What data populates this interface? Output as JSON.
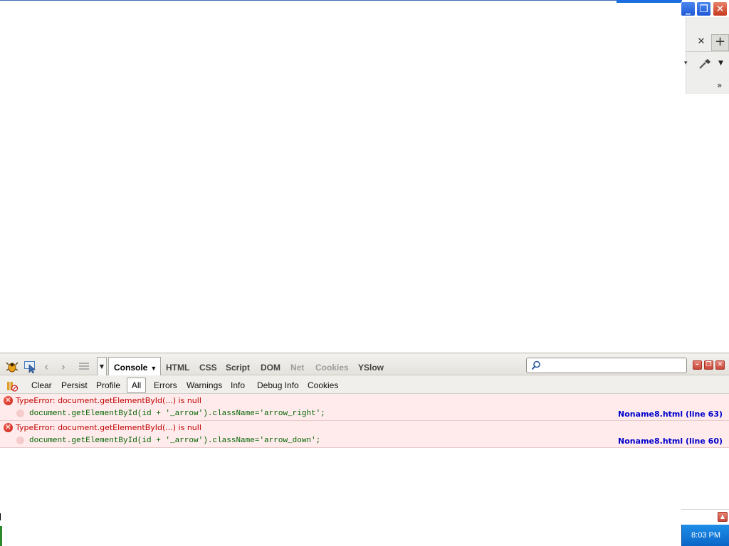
{
  "window": {
    "controls": [
      "minimize",
      "restore",
      "close"
    ]
  },
  "browser": {
    "tab_close_glyph": "✕",
    "new_tab_glyph": "+",
    "overflow_glyph": "»"
  },
  "firebug": {
    "tabs": [
      {
        "label": "Console",
        "active": true
      },
      {
        "label": "HTML",
        "active": false,
        "disabled": false
      },
      {
        "label": "CSS",
        "active": false,
        "disabled": false
      },
      {
        "label": "Script",
        "active": false,
        "disabled": false
      },
      {
        "label": "DOM",
        "active": false,
        "disabled": false
      },
      {
        "label": "Net",
        "active": false,
        "disabled": true
      },
      {
        "label": "Cookies",
        "active": false,
        "disabled": true
      },
      {
        "label": "YSlow",
        "active": false,
        "disabled": false
      }
    ],
    "search": {
      "value": "",
      "placeholder": ""
    },
    "console_toolbar": {
      "clear": "Clear",
      "persist": "Persist",
      "profile": "Profile",
      "filters": [
        "All",
        "Errors",
        "Warnings",
        "Info",
        "Debug Info",
        "Cookies"
      ],
      "active_filter": "All"
    },
    "log": [
      {
        "message": "TypeError: document.getElementById(...) is null",
        "code": "document.getElementById(id + '_arrow').className='arrow_right';",
        "source": "Noname8.html (line 63)"
      },
      {
        "message": "TypeError: document.getElementById(...) is null",
        "code": "document.getElementById(id + '_arrow').className='arrow_down';",
        "source": "Noname8.html (line 60)"
      }
    ]
  },
  "taskbar": {
    "clock": "8:03 PM"
  },
  "colors": {
    "error_text": "#c00000",
    "error_bg": "#ffebeb",
    "link": "#0000cc",
    "code": "#006400",
    "taskbar": "#0b66c7"
  }
}
